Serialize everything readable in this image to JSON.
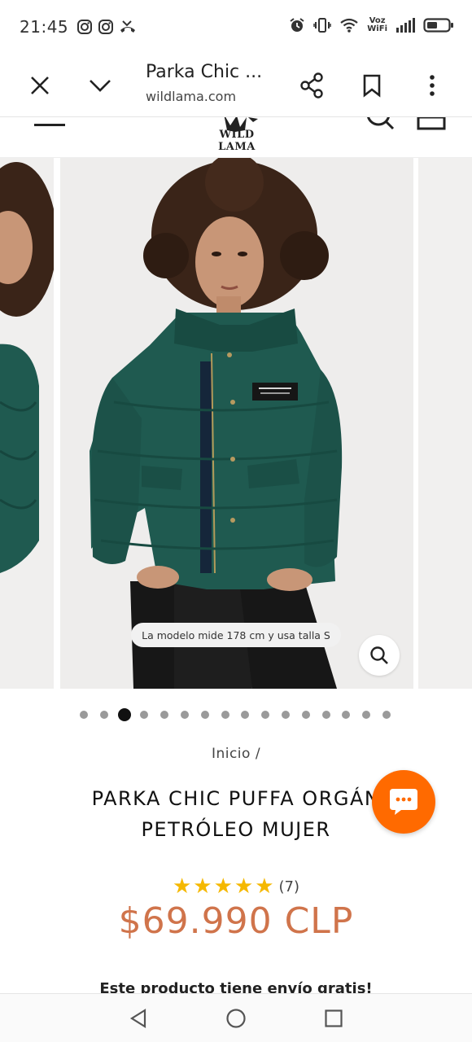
{
  "status_bar": {
    "time": "21:45",
    "left_icons": [
      "instagram-icon",
      "instagram-icon",
      "missed-call-icon"
    ],
    "right_icons": [
      "alarm-icon",
      "vibrate-icon",
      "wifi-icon",
      "voz-wifi-label",
      "signal-icon",
      "battery-icon"
    ],
    "voz_line1": "Voz",
    "voz_line2": "WiFi"
  },
  "toolbar": {
    "page_title": "Parka Chic ...",
    "url": "wildlama.com",
    "close_icon": "close-icon",
    "collapse_icon": "chevron-down-icon",
    "share_icon": "share-icon",
    "bookmark_icon": "bookmark-icon",
    "more_icon": "more-vert-icon"
  },
  "site_header": {
    "logo_text": "WILD LAMA"
  },
  "gallery": {
    "caption": "La modelo mide 178 cm y usa talla S",
    "zoom_icon": "zoom-icon",
    "dot_count": 16,
    "active_index": 2
  },
  "product": {
    "breadcrumb": "Inicio /",
    "title_line1": "PARKA CHIC PUFFA ORGÁN",
    "title_line2": "PETRÓLEO MUJER",
    "rating_stars": 5,
    "rating_count": "(7)",
    "price": "$69.990 CLP",
    "shipping_note": "Este producto tiene envío gratis!"
  },
  "colors": {
    "accent_orange": "#ff6a00",
    "price": "#d0744b",
    "star": "#f5b800",
    "jacket_green": "#1f5a50"
  }
}
